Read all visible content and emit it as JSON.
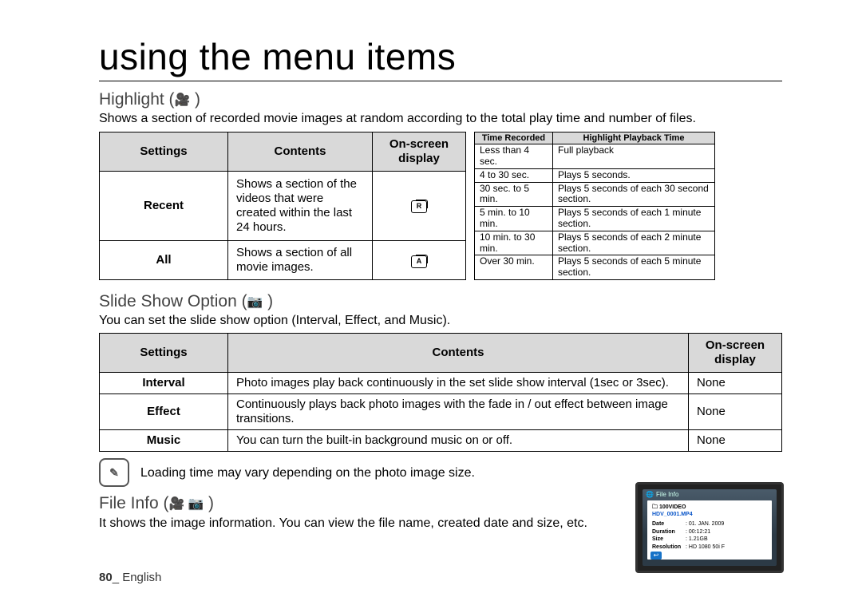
{
  "title": "using the menu items",
  "highlight": {
    "heading": "Highlight (",
    "heading_icon": "🎥",
    "heading_close": " )",
    "desc": "Shows a section of recorded movie images at random according to the total play time and number of files.",
    "table": {
      "headers": {
        "settings": "Settings",
        "contents": "Contents",
        "osd": "On-screen display"
      },
      "rows": [
        {
          "setting": "Recent",
          "content": "Shows a section of the videos that were created within the last 24 hours.",
          "osd": "R"
        },
        {
          "setting": "All",
          "content": "Shows a section of all movie images.",
          "osd": "A"
        }
      ]
    },
    "side": {
      "headers": {
        "time": "Time Recorded",
        "hpt": "Highlight Playback Time"
      },
      "rows": [
        {
          "time": "Less than 4 sec.",
          "hpt": "Full playback"
        },
        {
          "time": "4 to 30 sec.",
          "hpt": "Plays 5 seconds."
        },
        {
          "time": "30 sec. to 5 min.",
          "hpt": "Plays 5 seconds of each 30 second section."
        },
        {
          "time": "5 min. to 10 min.",
          "hpt": "Plays 5 seconds of each 1 minute section."
        },
        {
          "time": "10 min. to 30 min.",
          "hpt": "Plays 5 seconds of each 2 minute section."
        },
        {
          "time": "Over 30 min.",
          "hpt": "Plays 5 seconds of each 5 minute section."
        }
      ]
    }
  },
  "slideshow": {
    "heading": "Slide Show Option (",
    "heading_icon": "📷",
    "heading_close": " )",
    "desc": "You can set the slide show option (Interval, Effect, and Music).",
    "table": {
      "headers": {
        "settings": "Settings",
        "contents": "Contents",
        "osd": "On-screen display"
      },
      "rows": [
        {
          "setting": "Interval",
          "content": "Photo images play back continuously in the set slide show interval (1sec or 3sec).",
          "osd": "None"
        },
        {
          "setting": "Effect",
          "content": "Continuously plays back photo images with the fade in / out effect between image transitions.",
          "osd": "None"
        },
        {
          "setting": "Music",
          "content": "You can turn the built-in background music on or off.",
          "osd": "None"
        }
      ]
    },
    "note": "Loading time may vary depending on the photo image size."
  },
  "fileinfo": {
    "heading": "File Info (",
    "heading_icon": "🎥 📷",
    "heading_close": " )",
    "desc": "It shows the image information. You can view the file name, created date and size, etc.",
    "box": {
      "title": "File Info",
      "folder_icon": "🗀",
      "folder": "100VIDEO",
      "file": "HDV_0001.MP4",
      "rows": [
        {
          "k": "Date",
          "v": ": 01. JAN. 2009"
        },
        {
          "k": "Duration",
          "v": ": 00:12:21"
        },
        {
          "k": "Size",
          "v": ": 1.21GB"
        },
        {
          "k": "Resolution",
          "v": ": HD 1080 50i F"
        }
      ],
      "back": "↩"
    }
  },
  "footer": {
    "page": "80",
    "sep": "_ ",
    "lang": "English"
  }
}
